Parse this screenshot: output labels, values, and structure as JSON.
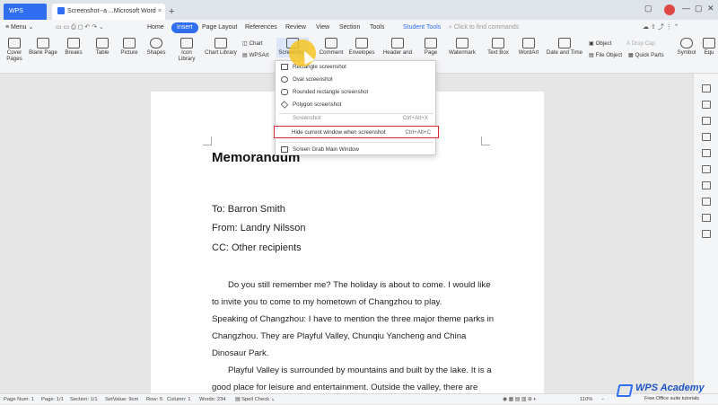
{
  "titlebar": {
    "app_tab": "WPS Office",
    "doc_tab": "Screenshot--a ...Microsoft Word",
    "close_glyph": "×",
    "new_tab_glyph": "+"
  },
  "menu": {
    "menu_label": "Menu",
    "tabs": [
      "Home",
      "Insert",
      "Page Layout",
      "References",
      "Review",
      "View",
      "Section",
      "Tools"
    ],
    "student_tools": "Student Tools",
    "search_placeholder": "Click to find commands"
  },
  "ribbon": {
    "cover_pages": "Cover Pages",
    "blank_page": "Blank Page",
    "breaks": "Breaks",
    "table": "Table",
    "picture": "Picture",
    "shapes": "Shapes",
    "icon_library": "Icon Library",
    "chart_library": "Chart Library",
    "chart": "Chart",
    "wpsart": "WPSArt",
    "screenshot": "Screenshot",
    "comment": "Comment",
    "envelopes": "Envelopes",
    "header_footer": "Header and",
    "page": "Page",
    "watermark": "Watermark",
    "text_box": "Text Box",
    "wordart": "WordArt",
    "date_time": "Date and Time",
    "object": "Object",
    "drop_cap": "Drop Cap",
    "file_object": "File Object",
    "quick_parts": "Quick Parts",
    "symbol": "Symbol",
    "equation": "Equ"
  },
  "dropdown": {
    "items": [
      "Rectangle screenshot",
      "Oval screenshot",
      "Rounded rectangle screenshot",
      "Polygon screenshot",
      "Screenshot",
      "Hide current window when screenshot",
      "Screen Grab Main Window"
    ],
    "shortcut_hidden": "Ctrl+Alt+X",
    "shortcut": "Ctrl+Alt+C"
  },
  "document": {
    "title": "Memorandum",
    "to": "To: Barron Smith",
    "from": "From: Landry Nilsson",
    "cc": "CC: Other recipients",
    "body": [
      "Do you still remember me? The holiday is about to come. I would like",
      "to invite you to come to my hometown of Changzhou to play.",
      "Speaking of Changzhou: I have to mention the three major theme parks in",
      "Changzhou. They are Playful Valley, Chunqiu Yancheng and China",
      "Dinosaur Park.",
      "Playful Valley is surrounded by mountains and built by the lake. It is a",
      "good place for leisure and entertainment. Outside the valley, there are"
    ]
  },
  "status": {
    "page_num": "Page Num: 1",
    "page": "Page: 1/1",
    "section": "Section: 1/1",
    "set_value": "SetValue: 9cm",
    "row": "Row: 5",
    "column": "Column: 1",
    "words": "Words: 234",
    "spell_check": "Spell Check",
    "zoom": "110%"
  },
  "watermark": {
    "brand": "WPS Academy",
    "tagline": "Free Office suite tutorials"
  },
  "colors": {
    "accent": "#2f6ef0",
    "highlight_border": "#d9272e",
    "cursor_halo": "#f5c423"
  }
}
